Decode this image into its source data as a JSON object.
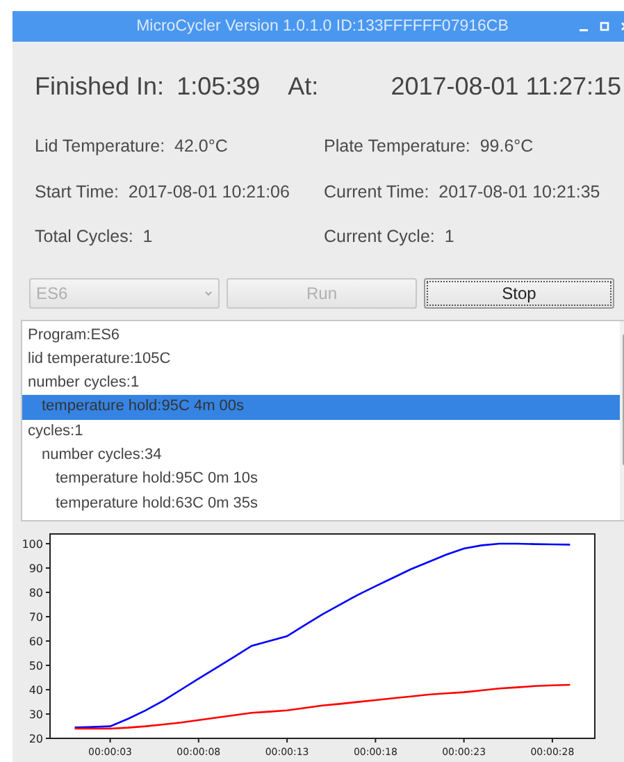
{
  "window": {
    "title": "MicroCycler Version 1.0.1.0  ID:133FFFFFF07916CB"
  },
  "summary": {
    "finished_label": "Finished In:",
    "finished_value": "1:05:39",
    "at_label": "At:",
    "at_value": "2017-08-01 11:27:15"
  },
  "fields": [
    {
      "label": "Lid Temperature:",
      "value": "42.0°C"
    },
    {
      "label": "Plate Temperature:",
      "value": "99.6°C"
    },
    {
      "label": "Start Time:",
      "value": "2017-08-01 10:21:06"
    },
    {
      "label": "Current Time:",
      "value": "2017-08-01 10:21:35"
    },
    {
      "label": "Total Cycles:",
      "value": "1"
    },
    {
      "label": "Current Cycle:",
      "value": "1"
    }
  ],
  "controls": {
    "program_select": {
      "value": "ES6",
      "disabled": true
    },
    "buttons": [
      {
        "label": "Run",
        "disabled": true
      },
      {
        "label": "Stop",
        "disabled": false
      }
    ]
  },
  "program_list": [
    {
      "text": "Program:ES6",
      "selected": false
    },
    {
      "text": "lid temperature:105C",
      "selected": false
    },
    {
      "text": "number cycles:1",
      "selected": false,
      "children": [
        {
          "text": "temperature hold:95C 4m 00s",
          "selected": true
        }
      ]
    },
    {
      "text": "cycles:1",
      "selected": false,
      "children": [
        {
          "text": "number cycles:34",
          "selected": false,
          "children": [
            {
              "text": "temperature hold:95C 0m 10s",
              "selected": false
            },
            {
              "text": "temperature hold:63C 0m 35s",
              "selected": false
            }
          ]
        }
      ]
    }
  ],
  "chart": {
    "chart_data": {
      "type": "line",
      "x": [
        1,
        2,
        3,
        4,
        5,
        6,
        7,
        8,
        9,
        10,
        11,
        12,
        13,
        14,
        15,
        16,
        17,
        18,
        19,
        20,
        21,
        22,
        23,
        24,
        25,
        26,
        27,
        28,
        29
      ],
      "series": [
        {
          "color": "#0000ff",
          "values": [
            24.5,
            24.7,
            25,
            28,
            31.5,
            35.5,
            40,
            44.5,
            49,
            53.5,
            58,
            60,
            62,
            66.5,
            71,
            75,
            79,
            82.5,
            86,
            89.5,
            92.5,
            95.5,
            98,
            99.3,
            100,
            100,
            99.8,
            99.7,
            99.6
          ]
        },
        {
          "color": "#ff0000",
          "values": [
            24,
            24,
            24,
            24.4,
            25,
            25.7,
            26.5,
            27.5,
            28.5,
            29.5,
            30.5,
            31,
            31.5,
            32.5,
            33.5,
            34.2,
            35,
            35.7,
            36.5,
            37.2,
            38,
            38.5,
            39,
            39.7,
            40.5,
            41,
            41.5,
            41.8,
            42
          ]
        }
      ],
      "xlim": [
        -0.4,
        30.4
      ],
      "ylim": [
        20,
        104
      ],
      "xticks": [
        {
          "value": 3,
          "label": "00:00:03"
        },
        {
          "value": 8,
          "label": "00:00:08"
        },
        {
          "value": 13,
          "label": "00:00:13"
        },
        {
          "value": 18,
          "label": "00:00:18"
        },
        {
          "value": 23,
          "label": "00:00:23"
        },
        {
          "value": 28,
          "label": "00:00:28"
        }
      ],
      "yticks": [
        20,
        30,
        40,
        50,
        60,
        70,
        80,
        90,
        100
      ]
    }
  }
}
